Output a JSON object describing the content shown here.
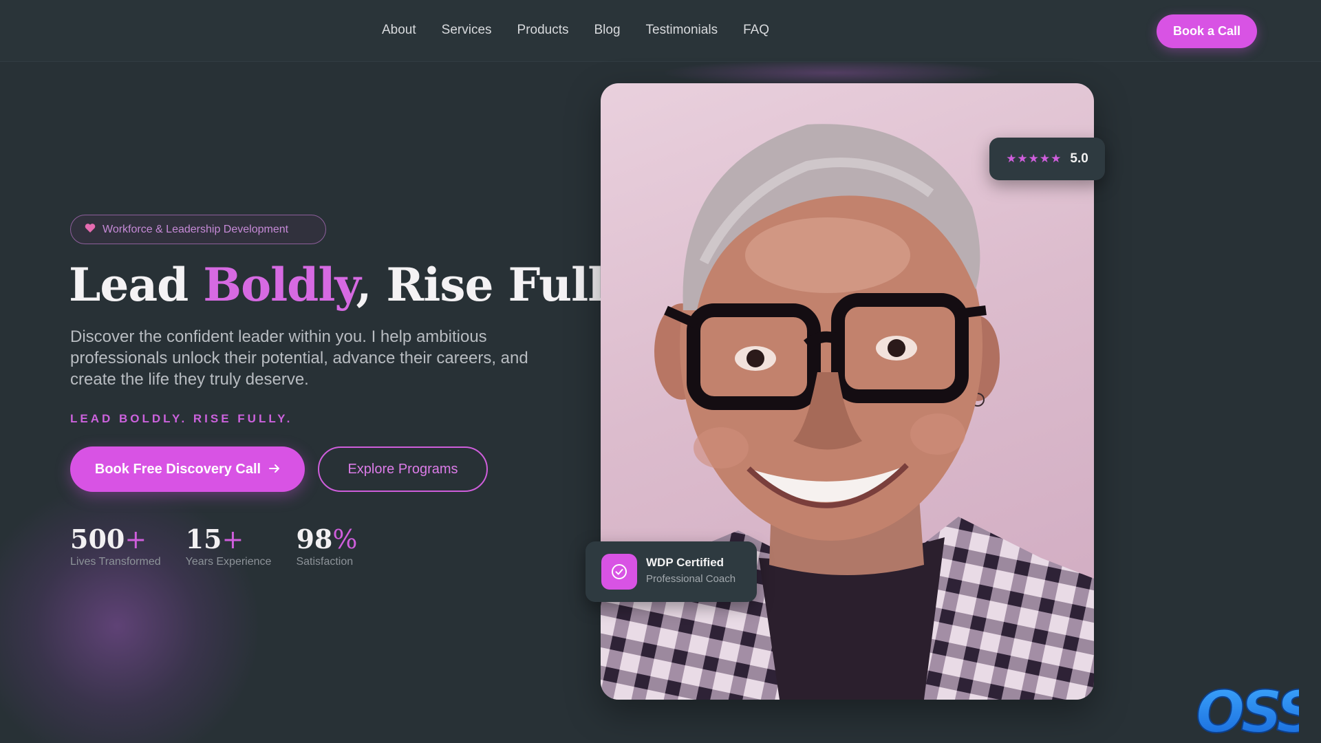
{
  "nav": {
    "links": [
      "About",
      "Services",
      "Products",
      "Blog",
      "Testimonials",
      "FAQ"
    ],
    "cta": "Book a Call"
  },
  "hero": {
    "badge_icon": "heart-icon",
    "badge": "Workforce & Leadership Development",
    "headline_part1": "Lead ",
    "headline_accent": "Boldly",
    "headline_part2": ", Rise Fully",
    "description": "Discover the confident leader within you. I help ambitious professionals unlock their potential, advance their careers, and create the life they truly deserve.",
    "tagline": "LEAD BOLDLY. RISE FULLY.",
    "primary_button": "Book Free Discovery Call",
    "primary_button_icon": "arrow-right-icon",
    "secondary_button": "Explore Programs"
  },
  "stats": [
    {
      "value": "500",
      "suffix": "+",
      "label": "Lives Transformed"
    },
    {
      "value": "15",
      "suffix": "+",
      "label": "Years Experience"
    },
    {
      "value": "98",
      "suffix": "%",
      "label": "Satisfaction"
    }
  ],
  "rating": {
    "stars": "★★★★★",
    "value": "5.0"
  },
  "certification": {
    "icon": "check-circle-icon",
    "title": "WDP Certified",
    "subtitle": "Professional Coach"
  },
  "watermark": {
    "text": "OSS"
  },
  "colors": {
    "background": "#283136",
    "accent": "#d853e4",
    "card": "#2e3a40"
  }
}
